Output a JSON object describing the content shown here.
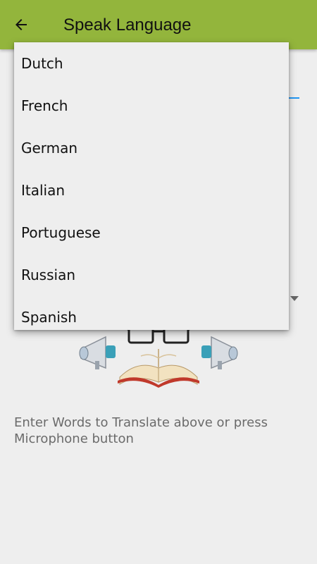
{
  "app_bar": {
    "title": "Speak Language",
    "back_icon": "arrow-back-icon",
    "background": "#93b53c"
  },
  "dropdown": {
    "items": [
      "Dutch",
      "French",
      "German",
      "Italian",
      "Portuguese",
      "Russian",
      "Spanish"
    ]
  },
  "content": {
    "hint": "Enter Words to Translate above or press Microphone button",
    "accent_color": "#2196f3",
    "illustration_icon": "speaker-book-illustration"
  }
}
